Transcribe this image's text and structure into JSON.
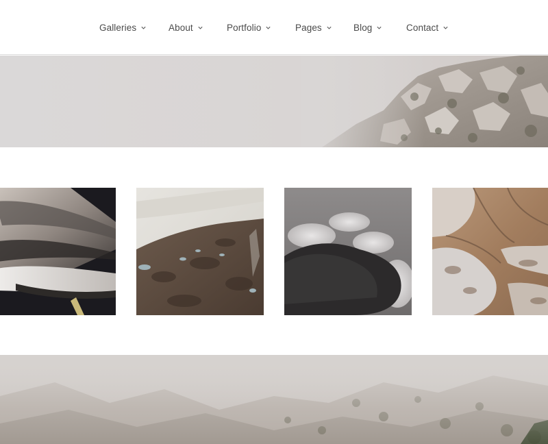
{
  "nav": {
    "items": [
      {
        "label": "Galleries"
      },
      {
        "label": "About"
      },
      {
        "label": "Portfolio"
      },
      {
        "label": "Pages"
      },
      {
        "label": "Blog"
      },
      {
        "label": "Contact"
      }
    ]
  },
  "hero_top": {
    "image": "foggy-cliffs-photo"
  },
  "thumbnails": [
    {
      "image": "feather-macro-photo"
    },
    {
      "image": "aerial-terrain-photo"
    },
    {
      "image": "storm-clouds-photo"
    },
    {
      "image": "eroded-rock-photo"
    }
  ],
  "hero_bottom": {
    "image": "misty-mountain-slope-photo"
  }
}
